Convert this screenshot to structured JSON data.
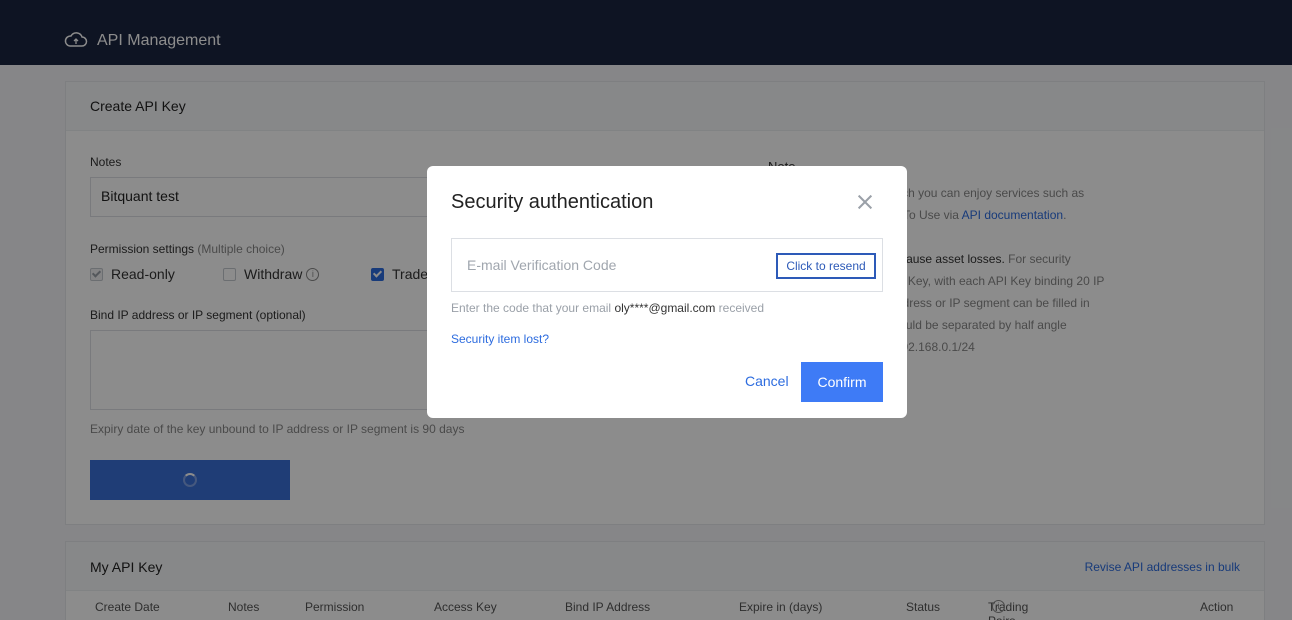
{
  "header": {
    "title": "API Management",
    "icon": "cloud-icon"
  },
  "create_panel": {
    "title": "Create API Key",
    "notes_label": "Notes",
    "notes_value": "Bitquant test",
    "permission_label": "Permission settings",
    "permission_hint": "(Multiple choice)",
    "permissions": [
      {
        "label": "Read-only",
        "checked": true,
        "disabled": true
      },
      {
        "label": "Withdraw",
        "checked": false,
        "disabled": false
      },
      {
        "label": "Trade",
        "checked": true,
        "disabled": false
      }
    ],
    "ip_label": "Bind IP address or IP segment (optional)",
    "expiry_text": "Expiry date of the key unbound to IP address or IP segment is 90 days",
    "note": {
      "title": "Note",
      "l1": "a strong API, through which you can enjoy services such as",
      "l2a": "c Trading, etc. View How To Use via ",
      "l2_link": "API documentation",
      "l2b": ".",
      "l3": "API Keys at most.",
      "l4_bold": "our API Key so as not to cause asset losses.",
      "l4_rest": " For security",
      "l5": "mended to bind IP for API Key, with each API Key binding 20 IP",
      "l6": "ts at most . A single IP address or IP segment can be filled in",
      "l7": "esses or IP segments should be separated by half angle",
      "l8": "92.168.1.1,192.168.1.2,192.168.0.1/24"
    }
  },
  "keys_panel": {
    "title": "My API Key",
    "revise_link": "Revise API addresses in bulk",
    "columns": [
      "Create Date",
      "Notes",
      "Permission",
      "Access Key",
      "Bind IP Address",
      "Expire in (days)",
      "Status",
      "Trading Pairs",
      "Action"
    ]
  },
  "modal": {
    "title": "Security authentication",
    "code_placeholder": "E-mail Verification Code",
    "resend_label": "Click to resend",
    "hint_prefix": "Enter the code that your email ",
    "hint_email": "oly****@gmail.com",
    "hint_suffix": " received",
    "lost_link": "Security item lost?",
    "cancel_label": "Cancel",
    "confirm_label": "Confirm"
  },
  "colors": {
    "header_bg": "#1b2540",
    "accent": "#3e7bf6",
    "link": "#2d6cdf"
  }
}
